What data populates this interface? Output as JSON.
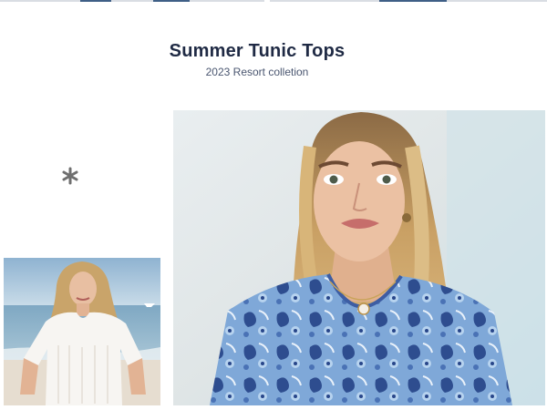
{
  "header": {
    "title": "Summer Tunic Tops",
    "subtitle": "2023 Resort colletion"
  },
  "icons": {
    "decor": "asterisk-icon"
  },
  "gallery": {
    "thumbnail": {
      "subject": "white-tee-beach-photo"
    },
    "hero": {
      "subject": "paisley-tunic-portrait-photo"
    }
  },
  "colors": {
    "title": "#1f2a44",
    "subtitle": "#4a5670",
    "accent": "#3f5f86"
  }
}
